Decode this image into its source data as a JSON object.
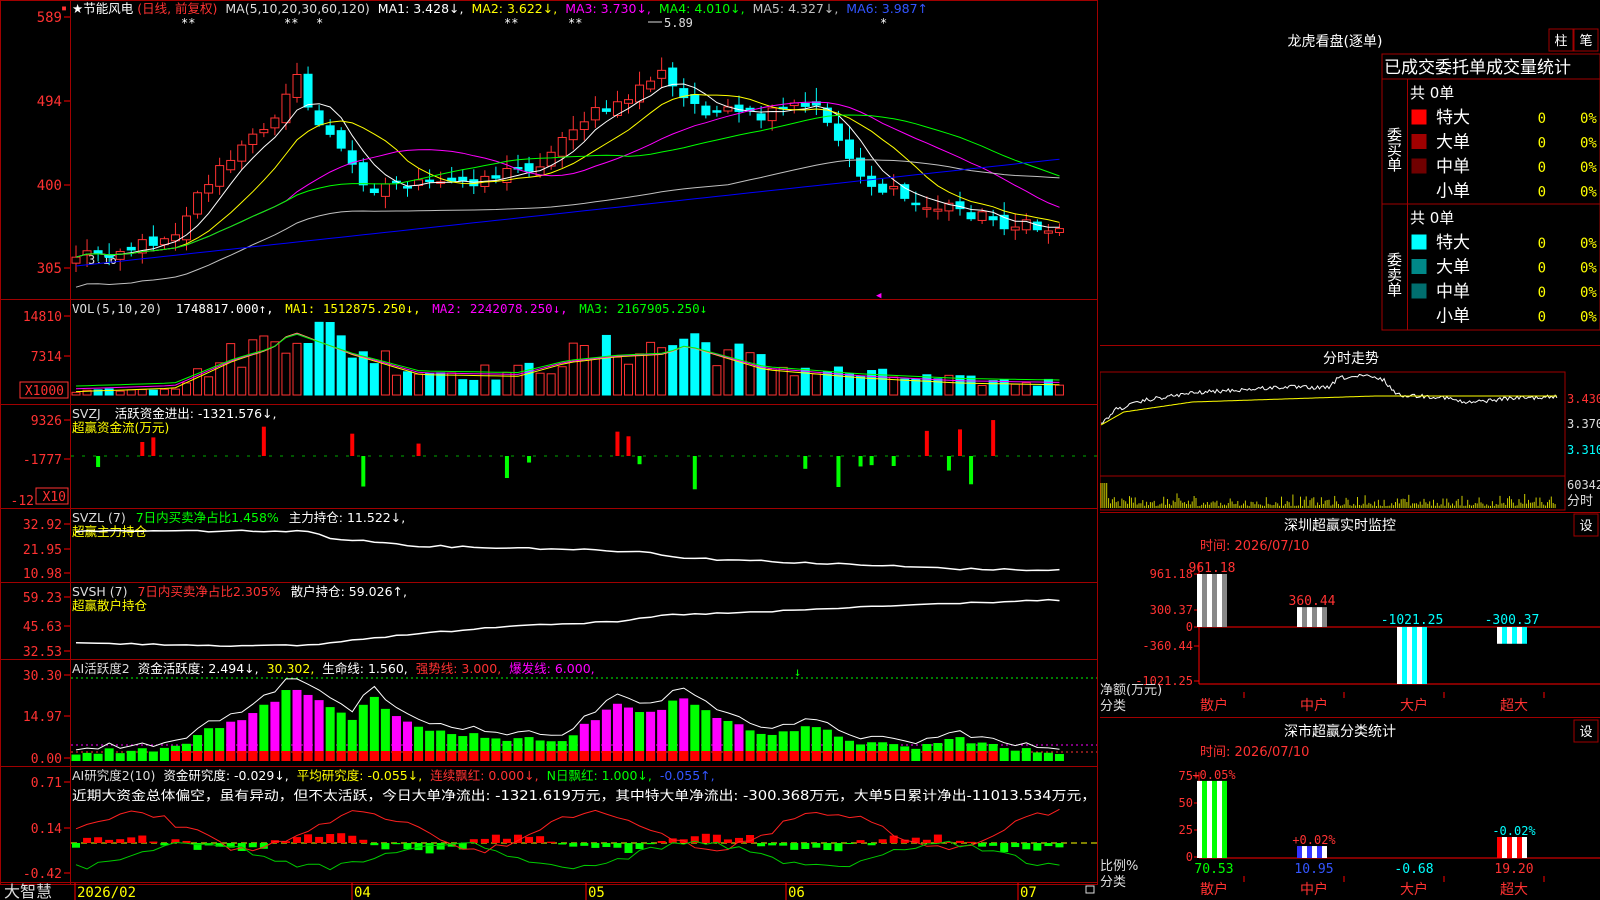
{
  "colors": {
    "up": "#ff3232",
    "down": "#00ffff",
    "ma1": "#ffffff",
    "ma2": "#ffff00",
    "ma3": "#ff00ff",
    "ma4": "#00ff00",
    "ma5": "#c0c0c0",
    "ma6": "#0000ff",
    "grid": "#a00000",
    "pos_bar": "#ff0000",
    "neg_bar": "#00ff00"
  },
  "price_panel": {
    "stock_name": "★节能风电",
    "period": "(日线, 前复权)",
    "ma_params": "MA(5,10,20,30,60,120)",
    "ma1": "MA1: 3.428↓,",
    "ma2": "MA2: 3.622↓,",
    "ma3": "MA3: 3.730↓,",
    "ma4": "MA4: 4.010↓,",
    "ma5": "MA5: 4.327↓,",
    "ma6": "MA6: 3.987↑",
    "y_labels": [
      "589",
      "494",
      "400",
      "305"
    ],
    "high_mark": "5.89",
    "low_mark": "3.16",
    "stars": [
      "**",
      "**",
      "*",
      "**",
      "**",
      "*"
    ]
  },
  "vol_panel": {
    "title": "VOL(5,10,20)",
    "value": "1748817.000↑,",
    "ma1": "MA1: 1512875.250↓,",
    "ma2": "MA2: 2242078.250↓,",
    "ma3": "MA3: 2167905.250↓",
    "y_labels": [
      "14810",
      "7314",
      "X1000"
    ]
  },
  "svzj_panel": {
    "title": "SVZJ",
    "label": "活跃资金进出: -1321.576↓,",
    "sub": "超赢资金流(万元)",
    "y_labels": [
      "9326",
      "-1777",
      "-12",
      "X10"
    ]
  },
  "svzl_panel": {
    "title": "SVZL (7)",
    "label1": "7日内买卖净占比1.458%",
    "label2": "主力持仓: 11.522↓,",
    "sub": "超赢主力持仓",
    "y_labels": [
      "32.92",
      "21.95",
      "10.98"
    ]
  },
  "svsh_panel": {
    "title": "SVSH (7)",
    "label1": "7日内买卖净占比2.305%",
    "label2": "散户持仓: 59.026↑,",
    "sub": "超赢散户持仓",
    "y_labels": [
      "59.23",
      "45.63",
      "32.53"
    ]
  },
  "ai1_panel": {
    "title": "AI活跃度2",
    "label1": "资金活跃度: 2.494↓,",
    "label2": "30.302,",
    "label3": "生命线: 1.560,",
    "label4": "强势线: 3.000,",
    "label5": "爆发线: 6.000,",
    "y_labels": [
      "30.30",
      "14.97",
      "0.00"
    ]
  },
  "ai2_panel": {
    "title": "AI研究度2(10)",
    "label1": "资金研究度: -0.029↓,",
    "label2": "平均研究度: -0.055↓,",
    "label3": "连续飘红: 0.000↓,",
    "label4": "N日飘红: 1.000↓,",
    "label5": "-0.055↑,",
    "comment": "近期大资金总体偏空，虽有异动，但不太活跃，今日大单净流出: -1321.619万元，其中特大单净流出: -300.368万元，大单5日累计净出-11013.534万元，",
    "y_labels": [
      "0.71",
      "0.14",
      "-0.42"
    ]
  },
  "x_axis": {
    "logo": "大智慧",
    "dates": [
      "2026/02",
      "04",
      "05",
      "06",
      "07"
    ]
  },
  "dragon_panel": {
    "title": "龙虎看盘(逐单)",
    "btn1": "柱",
    "btn2": "笔",
    "tab_text": "已成交委托单成交量统计",
    "buy_header": "共 0单",
    "buy_label": "委买单",
    "sell_header": "共 0单",
    "sell_label": "委卖单",
    "buy_rows": [
      {
        "name": "特大",
        "count": "0",
        "pct": "0%",
        "color": "#ff0000"
      },
      {
        "name": "大单",
        "count": "0",
        "pct": "0%",
        "color": "#a00000"
      },
      {
        "name": "中单",
        "count": "0",
        "pct": "0%",
        "color": "#700000"
      },
      {
        "name": "小单",
        "count": "0",
        "pct": "0%",
        "color": "#000000"
      }
    ],
    "sell_rows": [
      {
        "name": "特大",
        "count": "0",
        "pct": "0%",
        "color": "#00ffff"
      },
      {
        "name": "大单",
        "count": "0",
        "pct": "0%",
        "color": "#008888"
      },
      {
        "name": "中单",
        "count": "0",
        "pct": "0%",
        "color": "#006e6e"
      },
      {
        "name": "小单",
        "count": "0",
        "pct": "0%",
        "color": "#000000"
      }
    ]
  },
  "intraday_panel": {
    "title": "分时走势",
    "y_labels": [
      "3.430",
      "3.370",
      "3.310",
      "60342",
      "分时"
    ]
  },
  "monitor_panel": {
    "title": "深圳超赢实时监控",
    "btn": "设",
    "time": "时间: 2026/07/10",
    "y_labels": [
      "961.18",
      "300.37",
      "0",
      "-360.44",
      "-1021.25"
    ],
    "ylabel1": "净额(万元)",
    "ylabel2": "分类",
    "categories": [
      "散户",
      "中户",
      "大户",
      "超大"
    ]
  },
  "class_panel": {
    "title": "深市超赢分类统计",
    "btn": "设",
    "time": "时间: 2026/07/10",
    "y_labels": [
      "75",
      "50",
      "25",
      "0"
    ],
    "ylabel1": "比例%",
    "ylabel2": "分类",
    "categories": [
      "散户",
      "中户",
      "大户",
      "超大"
    ]
  },
  "chart_data": [
    {
      "type": "bar",
      "title": "深圳超赢实时监控",
      "categories": [
        "散户",
        "中户",
        "大户",
        "超大"
      ],
      "values": [
        961.18,
        360.44,
        -1021.25,
        -300.37
      ],
      "data_labels": [
        "961.18",
        "360.44",
        "-1021.25",
        "-300.37"
      ],
      "ylabel": "净额(万元)",
      "ylim": [
        -1021.25,
        961.18
      ]
    },
    {
      "type": "bar",
      "title": "深市超赢分类统计",
      "categories": [
        "散户",
        "中户",
        "大户",
        "超大"
      ],
      "values": [
        70.53,
        10.95,
        -0.68,
        19.2
      ],
      "top_labels": [
        "+0.05%",
        "+0.02%",
        "",
        "-0.02%"
      ],
      "bottom_labels": [
        "70.53",
        "10.95",
        "-0.68",
        "19.20"
      ],
      "ylabel": "比例%",
      "ylim": [
        0,
        75
      ]
    }
  ]
}
